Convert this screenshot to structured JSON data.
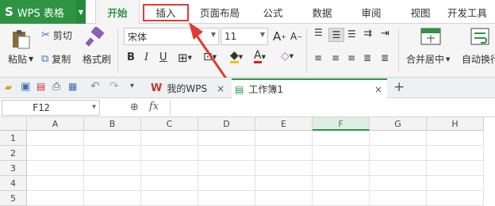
{
  "app": {
    "logo": "S",
    "name": "WPS 表格",
    "dropdown": "▼"
  },
  "tabs": [
    {
      "label": "开始",
      "active": true
    },
    {
      "label": "插入",
      "highlighted": true
    },
    {
      "label": "页面布局"
    },
    {
      "label": "公式"
    },
    {
      "label": "数据"
    },
    {
      "label": "审阅"
    },
    {
      "label": "视图"
    },
    {
      "label": "开发工具"
    }
  ],
  "ribbon": {
    "paste": "粘贴",
    "cut": "剪切",
    "copy": "复制",
    "format_painter": "格式刷",
    "font_name": "宋体",
    "font_size": "11",
    "merge_center": "合并居中",
    "wrap_text": "自动换行"
  },
  "quickbar": {
    "wps_tab": "我的WPS",
    "doc_tab": "工作簿1",
    "close": "×",
    "new_tab": "+"
  },
  "formula": {
    "cell_ref": "F12",
    "fx": "fx"
  },
  "grid": {
    "columns": [
      "A",
      "B",
      "C",
      "D",
      "E",
      "F",
      "G",
      "H"
    ],
    "rows": [
      "1",
      "2",
      "3",
      "4",
      "5"
    ],
    "active_column": "F"
  },
  "colors": {
    "brand": "#2e9444",
    "highlight": "#e03b35"
  }
}
